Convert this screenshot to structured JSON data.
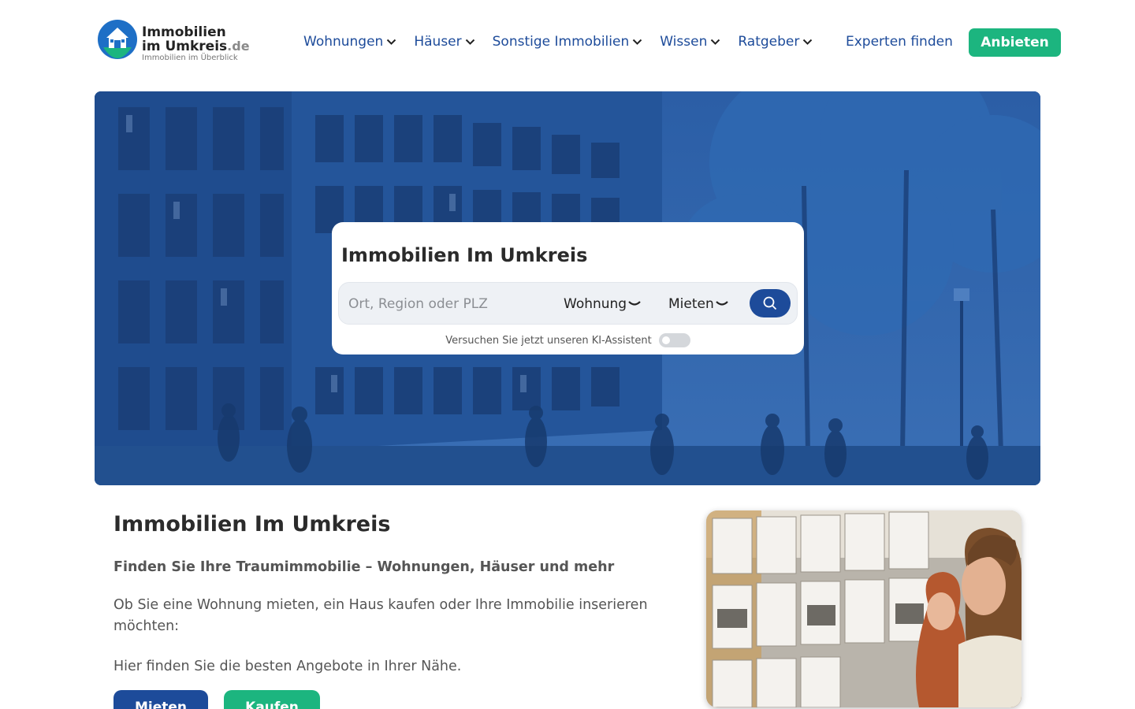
{
  "header": {
    "logo": {
      "line1": "Immobilien",
      "line2": "im Umkreis",
      "tld": ".de",
      "tagline": "Immobilien im Überblick"
    },
    "nav": [
      {
        "label": "Wohnungen"
      },
      {
        "label": "Häuser"
      },
      {
        "label": "Sonstige Immobilien"
      },
      {
        "label": "Wissen"
      },
      {
        "label": "Ratgeber"
      }
    ],
    "experts_label": "Experten finden",
    "cta_label": "Anbieten"
  },
  "search": {
    "title": "Immobilien Im Umkreis",
    "placeholder": "Ort, Region oder PLZ",
    "type_selected": "Wohnung",
    "mode_selected": "Mieten",
    "ki_text": "Versuchen Sie jetzt unseren KI-Assistent",
    "ki_enabled": false
  },
  "content": {
    "title": "Immobilien Im Umkreis",
    "subtitle": "Finden Sie Ihre Traumimmobilie – Wohnungen, Häuser und mehr",
    "paragraph1": "Ob Sie eine Wohnung mieten, ein Haus kaufen oder Ihre Immobilie inserieren möchten:",
    "paragraph2": "Hier finden Sie die besten Angebote in Ihrer Nähe.",
    "button_rent": "Mieten",
    "button_buy": "Kaufen"
  },
  "colors": {
    "primary_blue": "#1d4b9a",
    "accent_green": "#1cb57f",
    "hero_overlay": "#2a5fa6"
  },
  "icons": {
    "logo": "house-pin-icon",
    "nav_dropdown": "chevron-down-icon",
    "search": "search-icon"
  }
}
